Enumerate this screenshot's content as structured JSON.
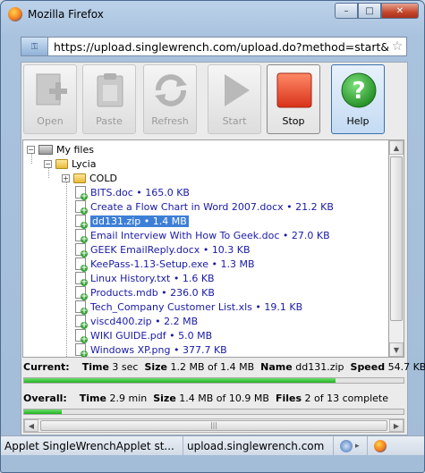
{
  "window": {
    "title": "Mozilla Firefox",
    "minimize": "–",
    "maximize": "□",
    "close": "✕"
  },
  "address": {
    "url": "https://upload.singlewrench.com/upload.do?method=start&server="
  },
  "toolbar": {
    "buttons": [
      {
        "label": "Open",
        "icon": "open-icon",
        "enabled": false
      },
      {
        "label": "Paste",
        "icon": "paste-icon",
        "enabled": false
      },
      {
        "label": "Refresh",
        "icon": "refresh-icon",
        "enabled": false
      },
      {
        "label": "Start",
        "icon": "play-icon",
        "enabled": false
      },
      {
        "label": "Stop",
        "icon": "stop-icon",
        "enabled": true
      },
      {
        "label": "Help",
        "icon": "help-icon",
        "enabled": true
      }
    ]
  },
  "tree": {
    "root": "My files",
    "folder": "Lycia",
    "subfolder": "COLD",
    "files": [
      {
        "name": "BITS.doc",
        "size": "165.0 KB"
      },
      {
        "name": "Create a Flow Chart in Word 2007.docx",
        "size": "21.2 KB"
      },
      {
        "name": "dd131.zip",
        "size": "1.4 MB",
        "selected": true
      },
      {
        "name": "Email Interview With How To Geek.doc",
        "size": "27.0 KB"
      },
      {
        "name": "GEEK EmailReply.docx",
        "size": "10.3 KB"
      },
      {
        "name": "KeePass-1.13-Setup.exe",
        "size": "1.3 MB"
      },
      {
        "name": "Linux History.txt",
        "size": "1.6 KB"
      },
      {
        "name": "Products.mdb",
        "size": "236.0 KB"
      },
      {
        "name": "Tech_Company Customer List.xls",
        "size": "19.1 KB"
      },
      {
        "name": "viscd400.zip",
        "size": "2.2 MB"
      },
      {
        "name": "WIKI GUIDE.pdf",
        "size": "5.0 MB"
      },
      {
        "name": "Windows XP.png",
        "size": "377.7 KB"
      }
    ]
  },
  "current": {
    "label": "Current:",
    "time_label": "Time",
    "time": "3 sec",
    "size_label": "Size",
    "size": "1.2 MB of 1.4 MB",
    "name_label": "Name",
    "name": "dd131.zip",
    "speed_label": "Speed",
    "speed": "54.7 KB",
    "progress": 0.82
  },
  "overall": {
    "label": "Overall:",
    "time_label": "Time",
    "time": "2.9 min",
    "size_label": "Size",
    "size": "1.4 MB of 10.9 MB",
    "files_label": "Files",
    "files": "2 of 13 complete",
    "progress": 0.1
  },
  "statusbar": {
    "applet": "Applet SingleWrenchApplet st...",
    "domain": "upload.singlewrench.com"
  },
  "colors": {
    "accent": "#3d7fd6",
    "progress": "#21b321",
    "stop": "#e2492a",
    "help": "#2f9a2f"
  }
}
